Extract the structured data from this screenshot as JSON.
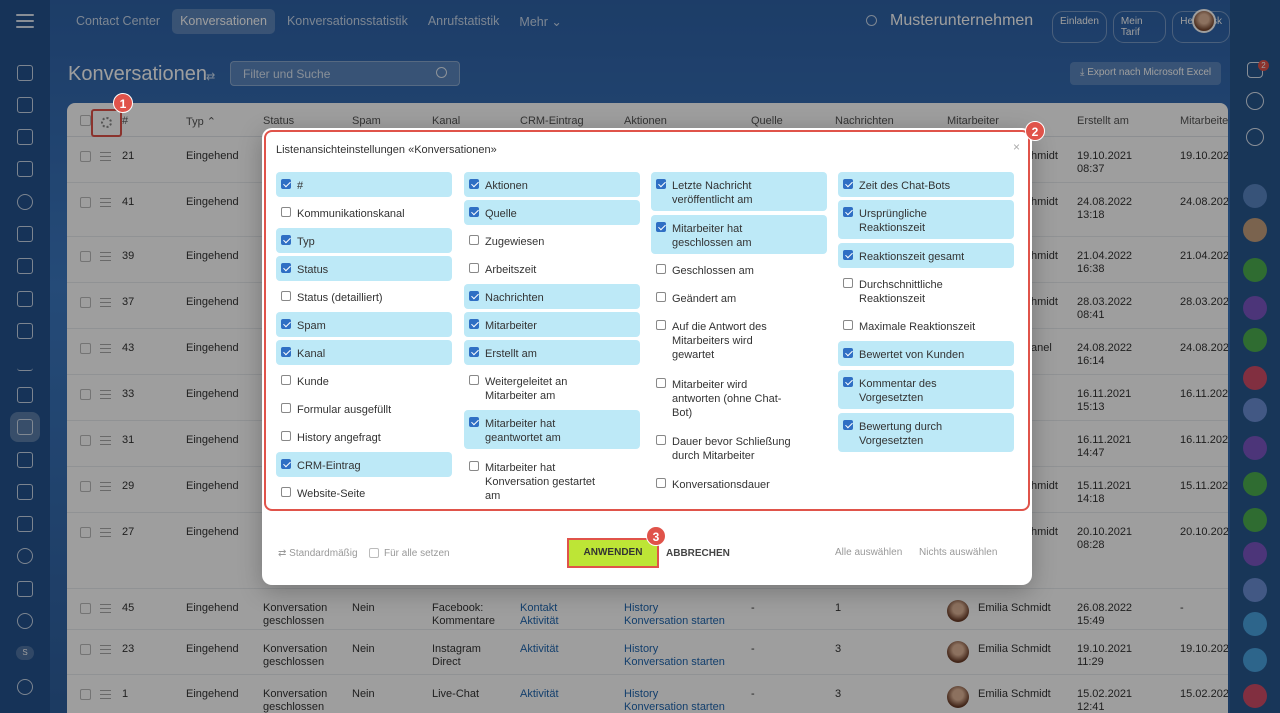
{
  "topnav": {
    "items": [
      "Contact Center",
      "Konversationen",
      "Konversationsstatistik",
      "Anrufstatistik",
      "Mehr ⌄"
    ],
    "company": "Musterunternehmen",
    "buttons": [
      "Einladen",
      "Mein Tarif",
      "Helpdesk"
    ]
  },
  "page": {
    "title": "Konversationen",
    "filter_placeholder": "Filter und Suche",
    "export_label": "⤓  Export nach Microsoft Excel"
  },
  "notifications": {
    "count": "2"
  },
  "left_badge": "S",
  "grid": {
    "headers": [
      "#",
      "Typ ⌃",
      "Status",
      "Spam",
      "Kanal",
      "CRM-Eintrag",
      "Aktionen",
      "Quelle",
      "Nachrichten",
      "Mitarbeiter",
      "Erstellt am",
      "Mitarbeite"
    ],
    "rows": [
      {
        "id": "21",
        "typ": "Eingehend",
        "tail": "hmidt",
        "created": "19.10.2021\n08:37",
        "last": "19.10.202"
      },
      {
        "id": "41",
        "typ": "Eingehend",
        "tail": "hmidt",
        "created": "24.08.2022\n13:18",
        "last": "24.08.202"
      },
      {
        "id": "39",
        "typ": "Eingehend",
        "tail": "hmidt",
        "created": "21.04.2022\n16:38",
        "last": "21.04.202"
      },
      {
        "id": "37",
        "typ": "Eingehend",
        "tail": "hmidt",
        "created": "28.03.2022\n08:41",
        "last": "28.03.202"
      },
      {
        "id": "43",
        "typ": "Eingehend",
        "tail": "anel",
        "created": "24.08.2022\n16:14",
        "last": "24.08.202"
      },
      {
        "id": "33",
        "typ": "Eingehend",
        "tail": "",
        "created": "16.11.2021\n15:13",
        "last": "16.11.202"
      },
      {
        "id": "31",
        "typ": "Eingehend",
        "tail": "",
        "created": "16.11.2021\n14:47",
        "last": "16.11.202"
      },
      {
        "id": "29",
        "typ": "Eingehend",
        "tail": "hmidt",
        "created": "15.11.2021\n14:18",
        "last": "15.11.202"
      },
      {
        "id": "27",
        "typ": "Eingehend",
        "tail": "hmidt",
        "created": "20.10.2021\n08:28",
        "last": "20.10.202"
      },
      {
        "id": "45",
        "typ": "Eingehend",
        "status": "Konversation\ngeschlossen",
        "spam": "Nein",
        "kanal": "Facebook:\nKommentare",
        "crm": "Kontakt\nAktivität",
        "aktionen": "History\nKonversation starten",
        "quelle": "-",
        "nachrichten": "1",
        "mitarbeiter": "Emilia Schmidt",
        "created": "26.08.2022\n15:49",
        "last": "-"
      },
      {
        "id": "23",
        "typ": "Eingehend",
        "status": "Konversation\ngeschlossen",
        "spam": "Nein",
        "kanal": "Instagram\nDirect",
        "crm": "Aktivität",
        "aktionen": "History\nKonversation starten",
        "quelle": "-",
        "nachrichten": "3",
        "mitarbeiter": "Emilia Schmidt",
        "created": "19.10.2021\n11:29",
        "last": "19.10.202"
      },
      {
        "id": "1",
        "typ": "Eingehend",
        "status": "Konversation\ngeschlossen",
        "spam": "Nein",
        "kanal": "Live-Chat",
        "crm": "Aktivität",
        "aktionen": "History\nKonversation starten",
        "quelle": "-",
        "nachrichten": "3",
        "mitarbeiter": "Emilia Schmidt",
        "created": "15.02.2021\n12:41",
        "last": "15.02.202"
      }
    ]
  },
  "dialog": {
    "title": "Listenansichteinstellungen «Konversationen»",
    "close": "×",
    "columns": [
      [
        {
          "label": "#",
          "checked": true
        },
        {
          "label": "Kommunikationskanal",
          "checked": false
        },
        {
          "label": "Typ",
          "checked": true
        },
        {
          "label": "Status",
          "checked": true
        },
        {
          "label": "Status (detailliert)",
          "checked": false
        },
        {
          "label": "Spam",
          "checked": true
        },
        {
          "label": "Kanal",
          "checked": true
        },
        {
          "label": "Kunde",
          "checked": false
        },
        {
          "label": "Formular ausgefüllt",
          "checked": false
        },
        {
          "label": "History angefragt",
          "checked": false
        },
        {
          "label": "CRM-Eintrag",
          "checked": true
        },
        {
          "label": "Website-Seite",
          "checked": false
        }
      ],
      [
        {
          "label": "Aktionen",
          "checked": true
        },
        {
          "label": "Quelle",
          "checked": true
        },
        {
          "label": "Zugewiesen",
          "checked": false
        },
        {
          "label": "Arbeitszeit",
          "checked": false
        },
        {
          "label": "Nachrichten",
          "checked": true
        },
        {
          "label": "Mitarbeiter",
          "checked": true
        },
        {
          "label": "Erstellt am",
          "checked": true
        },
        {
          "label": "Weitergeleitet an\nMitarbeiter am",
          "checked": false
        },
        {
          "label": "Mitarbeiter hat\ngeantwortet am",
          "checked": true
        },
        {
          "label": "Mitarbeiter hat\nKonversation gestartet\nam",
          "checked": false
        }
      ],
      [
        {
          "label": "Letzte Nachricht\nveröffentlicht am",
          "checked": true
        },
        {
          "label": "Mitarbeiter hat\ngeschlossen am",
          "checked": true
        },
        {
          "label": "Geschlossen am",
          "checked": false
        },
        {
          "label": "Geändert am",
          "checked": false
        },
        {
          "label": "Auf die Antwort des\nMitarbeiters wird\ngewartet",
          "checked": false
        },
        {
          "label": "Mitarbeiter wird\nantworten (ohne Chat-\nBot)",
          "checked": false
        },
        {
          "label": "Dauer bevor Schließung\ndurch Mitarbeiter",
          "checked": false
        },
        {
          "label": "Konversationsdauer",
          "checked": false
        }
      ],
      [
        {
          "label": "Zeit des Chat-Bots",
          "checked": true
        },
        {
          "label": "Ursprüngliche\nReaktionszeit",
          "checked": true
        },
        {
          "label": "Reaktionszeit gesamt",
          "checked": true
        },
        {
          "label": "Durchschnittliche\nReaktionszeit",
          "checked": false
        },
        {
          "label": "Maximale Reaktionszeit",
          "checked": false
        },
        {
          "label": "Bewertet von Kunden",
          "checked": true
        },
        {
          "label": "Kommentar des\nVorgesetzten",
          "checked": true
        },
        {
          "label": "Bewertung durch\nVorgesetzten",
          "checked": true
        }
      ]
    ],
    "footer": {
      "default_label": "⇄ Standardmäßig",
      "set_all_label": "Für alle setzen",
      "apply_label": "ANWENDEN",
      "cancel_label": "ABBRECHEN",
      "select_all_label": "Alle auswählen",
      "select_none_label": "Nichts auswählen"
    }
  },
  "callouts": [
    "1",
    "2",
    "3"
  ],
  "colors": {
    "accent_red": "#e0534a",
    "checked_bg": "#bde9f7",
    "apply_green": "#bde536"
  }
}
